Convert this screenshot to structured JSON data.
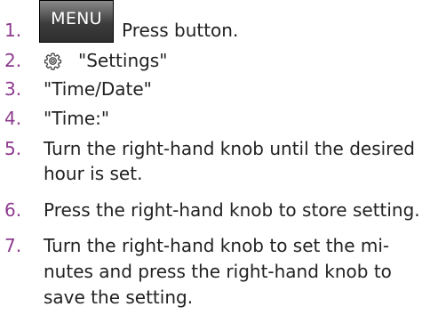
{
  "steps": [
    {
      "number": "1.",
      "button_label": "MENU",
      "text": "Press button."
    },
    {
      "number": "2.",
      "icon": "gear-icon",
      "text": "\"Settings\""
    },
    {
      "number": "3.",
      "text": "\"Time/Date\""
    },
    {
      "number": "4.",
      "text": "\"Time:\""
    },
    {
      "number": "5.",
      "lines": [
        "Turn the right-hand knob until the desired",
        "hour is set."
      ]
    },
    {
      "number": "6.",
      "text": "Press the right-hand knob to store setting."
    },
    {
      "number": "7.",
      "lines": [
        "Turn the right-hand knob to set the mi-",
        "nutes and press the right-hand knob to",
        "save the setting."
      ]
    }
  ],
  "colors": {
    "step_number": "#8e3a8e",
    "text": "#222222"
  }
}
